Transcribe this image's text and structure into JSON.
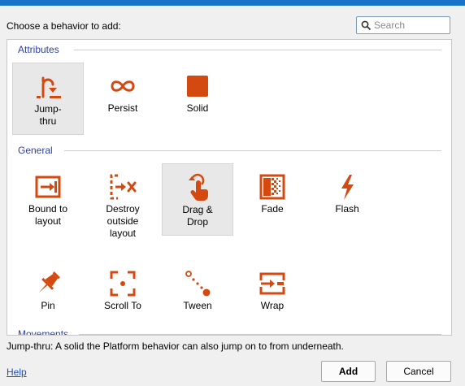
{
  "dialog": {
    "prompt": "Choose a behavior to add:",
    "search_placeholder": "Search",
    "description": "Jump-thru: A solid the Platform behavior can also jump on to from underneath.",
    "help_label": "Help",
    "add_label": "Add",
    "cancel_label": "Cancel"
  },
  "accent_color": "#d4490f",
  "categories": [
    {
      "name": "Attributes"
    },
    {
      "name": "General"
    },
    {
      "name": "Movements"
    }
  ],
  "behaviors": {
    "jump_thru": {
      "label": "Jump-\nthru",
      "icon": "jump-thru-icon",
      "selected": true
    },
    "persist": {
      "label": "Persist",
      "icon": "persist-icon"
    },
    "solid": {
      "label": "Solid",
      "icon": "solid-icon"
    },
    "bound_to_layout": {
      "label": "Bound to\nlayout",
      "icon": "bound-to-layout-icon"
    },
    "destroy_outside_layout": {
      "label": "Destroy\noutside\nlayout",
      "icon": "destroy-outside-layout-icon"
    },
    "drag_drop": {
      "label": "Drag &\nDrop",
      "icon": "drag-drop-icon"
    },
    "fade": {
      "label": "Fade",
      "icon": "fade-icon"
    },
    "flash": {
      "label": "Flash",
      "icon": "flash-icon"
    },
    "pin": {
      "label": "Pin",
      "icon": "pin-icon"
    },
    "scroll_to": {
      "label": "Scroll To",
      "icon": "scroll-to-icon"
    },
    "tween": {
      "label": "Tween",
      "icon": "tween-icon"
    },
    "wrap": {
      "label": "Wrap",
      "icon": "wrap-icon"
    }
  }
}
